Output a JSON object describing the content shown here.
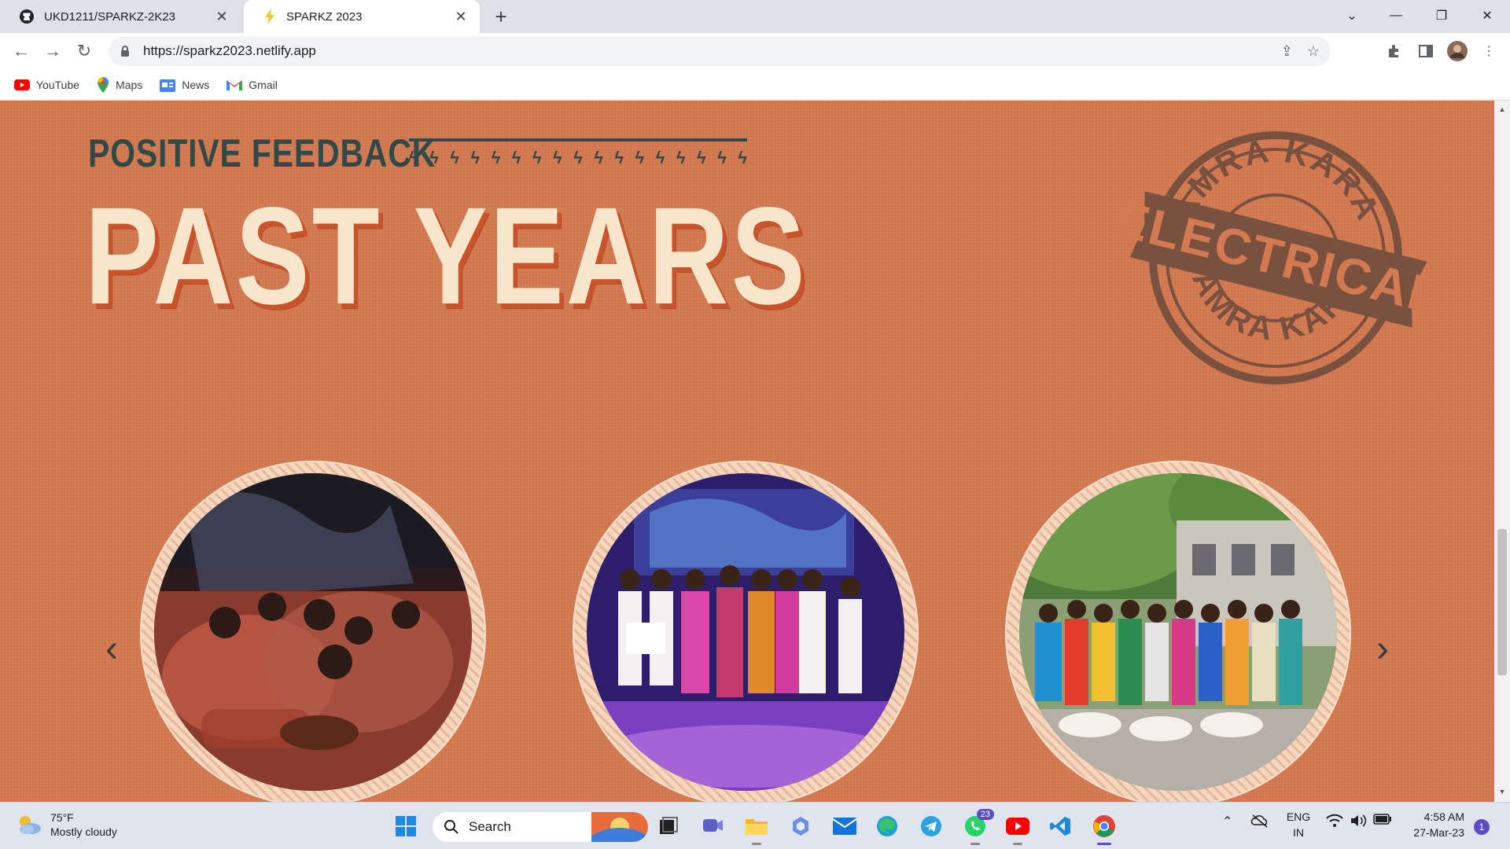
{
  "browser": {
    "tabs": [
      {
        "title": "UKD1211/SPARKZ-2K23",
        "icon": "github-icon",
        "active": false
      },
      {
        "title": "SPARKZ 2023",
        "icon": "lightning-bolt-icon",
        "active": true
      }
    ],
    "url": "https://sparkz2023.netlify.app",
    "bookmarks": [
      {
        "label": "YouTube",
        "icon": "youtube-icon"
      },
      {
        "label": "Maps",
        "icon": "maps-icon"
      },
      {
        "label": "News",
        "icon": "google-news-icon"
      },
      {
        "label": "Gmail",
        "icon": "gmail-icon"
      }
    ]
  },
  "page": {
    "subtitle": "POSITIVE FEEDBACK",
    "headline": "PAST YEARS",
    "stamp": {
      "top_text": "AMRA KARA",
      "band_text": "ELECTRICAL",
      "bottom_text": "AMRA KARA"
    },
    "gallery": [
      {
        "name": "performance-photo",
        "icon": "photo-icon"
      },
      {
        "name": "stage-group-photo",
        "icon": "photo-icon"
      },
      {
        "name": "campus-group-photo",
        "icon": "photo-icon"
      }
    ]
  },
  "colors": {
    "page_bg": "#d47a52",
    "headline": "#f6e6cc",
    "headline_shadow": "#c9542b",
    "subtitle": "#2f4a49",
    "stamp": "#6b4a3c"
  },
  "taskbar": {
    "weather_temp": "75°F",
    "weather_desc": "Mostly cloudy",
    "search_placeholder": "Search",
    "whatsapp_badge": "23",
    "lang_top": "ENG",
    "lang_bottom": "IN",
    "time": "4:58 AM",
    "date": "27-Mar-23",
    "notification_count": "1"
  }
}
